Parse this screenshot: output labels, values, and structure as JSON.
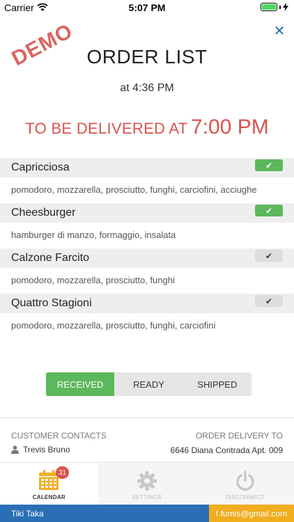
{
  "status_bar": {
    "carrier": "Carrier",
    "time": "5:07 PM"
  },
  "demo_stamp": "DEMO",
  "close_icon": "close-icon",
  "title": "ORDER LIST",
  "order_time": "at 4:36 PM",
  "delivery": {
    "label": "TO BE DELIVERED AT",
    "time": "7:00 PM"
  },
  "items": [
    {
      "name": "Capricciosa",
      "desc": "pomodoro, mozzarella, prosciutto, funghi, carciofini, acciughe",
      "checked": true
    },
    {
      "name": "Cheesburger",
      "desc": "hamburger di manzo, formaggio, insalata",
      "checked": true
    },
    {
      "name": "Calzone Farcito",
      "desc": "pomodoro, mozzarella, prosciutto, funghi",
      "checked": false
    },
    {
      "name": "Quattro Stagioni",
      "desc": "pomodoro, mozzarella, prosciutto, funghi, carciofini",
      "checked": false
    }
  ],
  "segments": {
    "received": "RECEIVED",
    "ready": "READY",
    "shipped": "SHIPPED",
    "active": "received"
  },
  "customer": {
    "contacts_label": "CUSTOMER CONTACTS",
    "name": "Trevis Bruno",
    "delivery_label": "ORDER DELIVERY TO",
    "address": "6646 Diana Contrada Apt. 009"
  },
  "tabs": {
    "calendar": {
      "label": "CALENDAR",
      "badge": "31"
    },
    "settings": {
      "label": "SETTINGS"
    },
    "disconnect": {
      "label": "DISCONNECT"
    }
  },
  "footer": {
    "app_name": "Tiki Taka",
    "email": "f.fumis@gmail.com"
  },
  "colors": {
    "accent_red": "#d9534f",
    "accent_green": "#5cb85c",
    "brand_blue": "#2a6fb5",
    "footer_orange": "#f0ad1e"
  }
}
